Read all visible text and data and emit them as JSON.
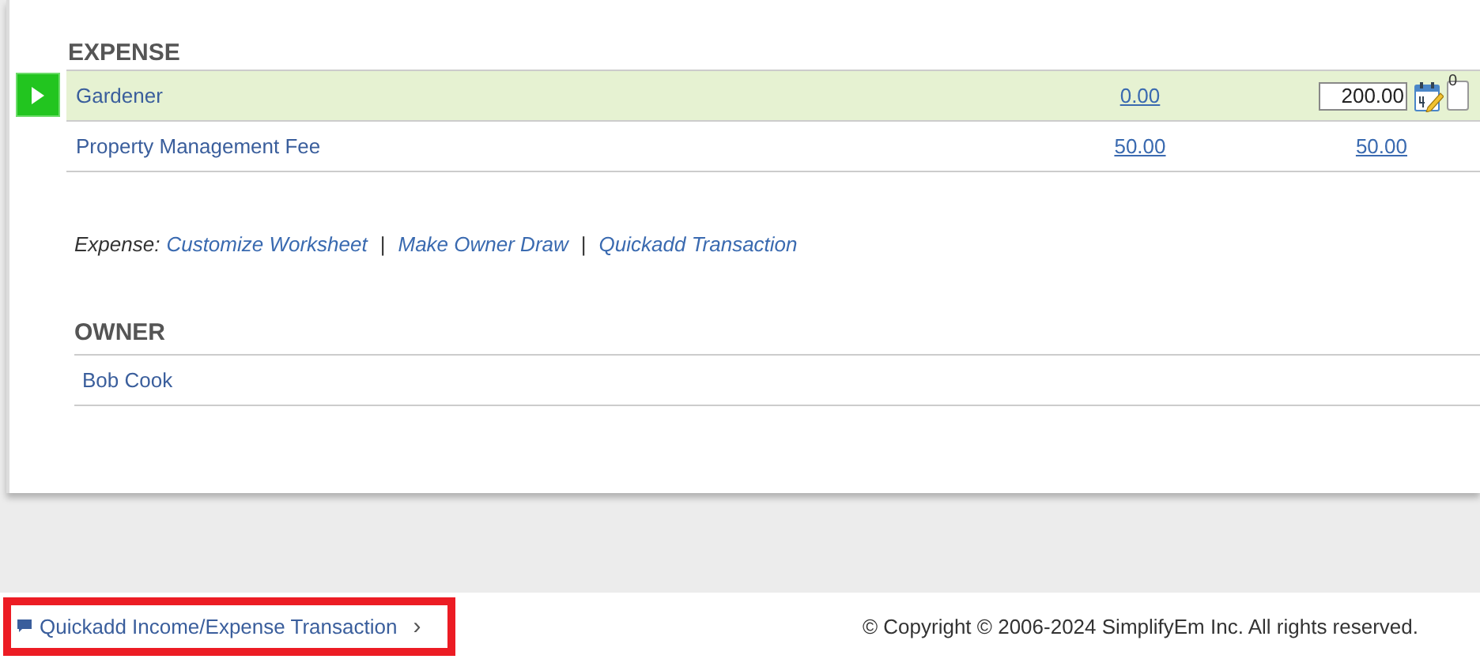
{
  "expense": {
    "title": "EXPENSE",
    "rows": [
      {
        "name": "Gardener",
        "selected": true,
        "amount": "0.00",
        "kind": "input",
        "value": "200.00",
        "note_count": "0"
      },
      {
        "name": "Property Management Fee",
        "selected": false,
        "amount": "50.00",
        "kind": "link",
        "value": "50.00"
      }
    ],
    "actions": {
      "label": "Expense:",
      "links": [
        "Customize Worksheet",
        "Make Owner Draw",
        "Quickadd Transaction"
      ],
      "separator": "|"
    }
  },
  "owner": {
    "title": "OWNER",
    "rows": [
      "Bob Cook"
    ]
  },
  "footer": {
    "quickadd_link": "Quickadd Income/Expense Transaction",
    "chevron": "›",
    "highlighted": true,
    "copyright": "© Copyright © 2006-2024 SimplifyEm Inc. All rights reserved."
  }
}
